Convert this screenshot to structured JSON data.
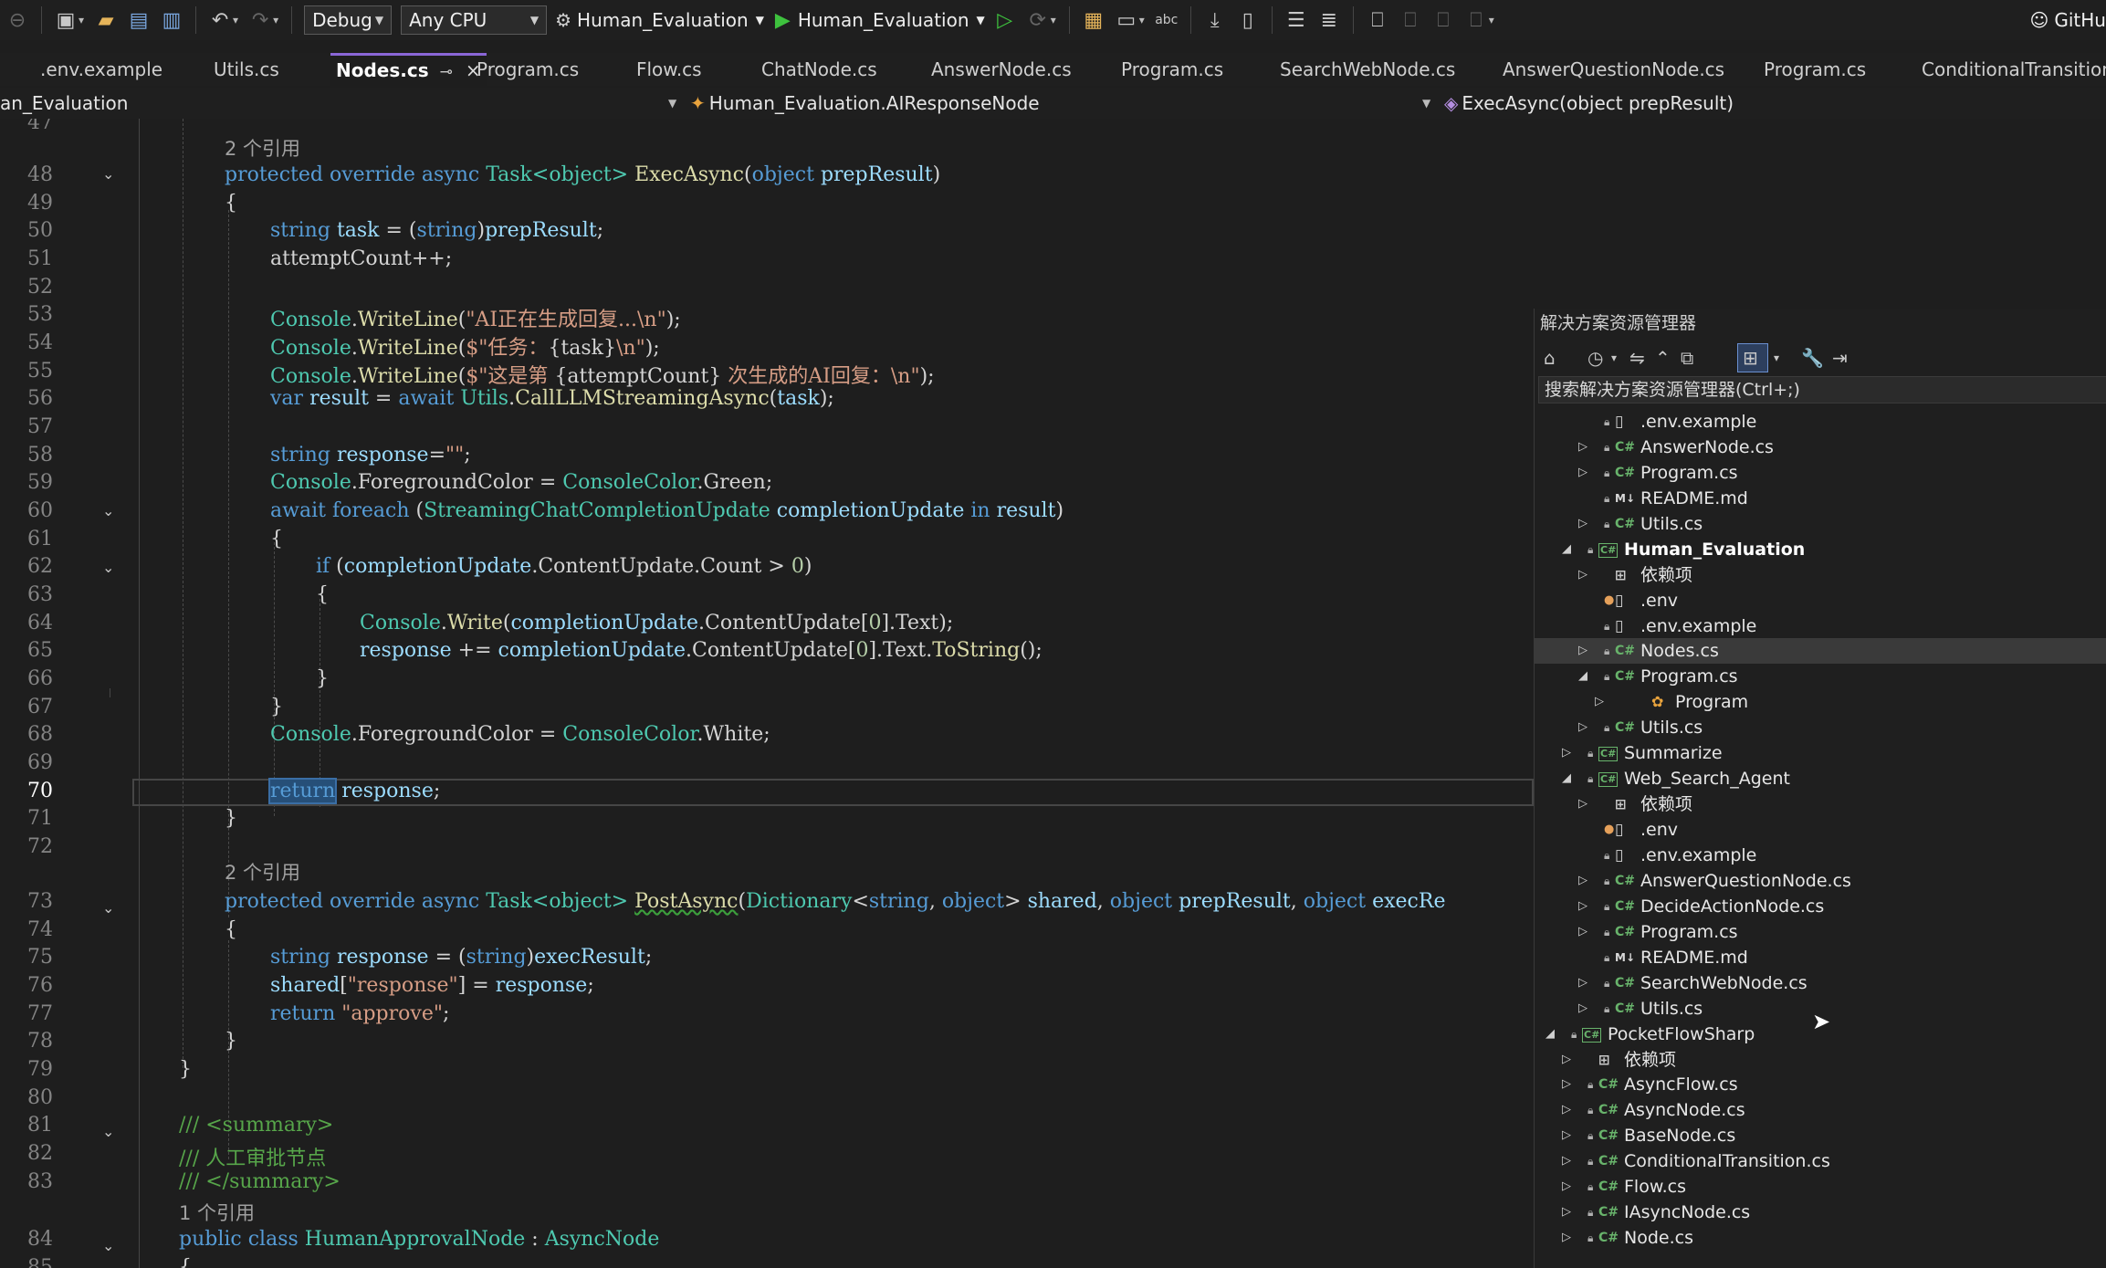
{
  "toolbar": {
    "configuration": "Debug",
    "platform": "Any CPU",
    "startup_project": "Human_Evaluation",
    "run_target": "Human_Evaluation",
    "github_label": "GitHu"
  },
  "tabs": [
    {
      "label": ".env.example"
    },
    {
      "label": "Utils.cs"
    },
    {
      "label": "Nodes.cs",
      "active": true
    },
    {
      "label": "Program.cs"
    },
    {
      "label": "Flow.cs"
    },
    {
      "label": "ChatNode.cs"
    },
    {
      "label": "AnswerNode.cs"
    },
    {
      "label": "Program.cs"
    },
    {
      "label": "SearchWebNode.cs"
    },
    {
      "label": "AnswerQuestionNode.cs"
    },
    {
      "label": "Program.cs"
    },
    {
      "label": "ConditionalTransition.cs"
    }
  ],
  "navbar": {
    "project": "an_Evaluation",
    "type": "Human_Evaluation.AIResponseNode",
    "member": "ExecAsync(object prepResult)"
  },
  "editor": {
    "line_numbers": [
      "47",
      "48",
      "49",
      "50",
      "51",
      "52",
      "53",
      "54",
      "55",
      "56",
      "57",
      "58",
      "59",
      "60",
      "61",
      "62",
      "63",
      "64",
      "65",
      "66",
      "67",
      "68",
      "69",
      "70",
      "71",
      "72",
      "73",
      "74",
      "75",
      "76",
      "77",
      "78",
      "79",
      "80",
      "81",
      "82",
      "83",
      "84",
      "85"
    ],
    "current_line": "70",
    "codelens": {
      "exec": "2 个引用",
      "post": "2 个引用",
      "class": "1 个引用"
    },
    "tokens": {
      "protected": "protected",
      "override": "override",
      "async": "async",
      "task_obj": "Task<object>",
      "exec_async": "ExecAsync",
      "object": "object",
      "prep_result": "prepResult",
      "string": "string",
      "task": "task",
      "attempt_count": "attemptCount++;",
      "console": "Console",
      "write_line": "WriteLine",
      "write": "Write",
      "str1": "\"AI正在生成回复...\\n\"",
      "str2a": "$\"任务：",
      "str2b": "{task}",
      "str2c": "\\n\"",
      "str3a": "$\"这是第 ",
      "str3b": "{attemptCount}",
      "str3c": " 次生成的AI回复：\\n\"",
      "var": "var",
      "result": "result",
      "await": "await",
      "utils": "Utils",
      "call_llm": "CallLLMStreamingAsync",
      "response": "response",
      "empty_str": "\"\"",
      "foreground": "ForegroundColor",
      "console_color": "ConsoleColor",
      "green": "Green",
      "white": "White",
      "foreach": "foreach",
      "streaming": "StreamingChatCompletionUpdate",
      "completion_update": "completionUpdate",
      "in": "in",
      "if": "if",
      "content_update": "ContentUpdate",
      "count": "Count",
      "zero": "0",
      "text": "Text",
      "to_string": "ToString",
      "return": "return",
      "post_async": "PostAsync",
      "dictionary": "Dictionary",
      "shared": "shared",
      "exec_re": "execRe",
      "exec_result": "execResult",
      "str_response": "\"response\"",
      "str_approve": "\"approve\"",
      "sum_open": "/// <summary>",
      "sum_text": "/// 人工审批节点",
      "sum_close": "/// </summary>",
      "public": "public",
      "class": "class",
      "human_approval": "HumanApprovalNode",
      "async_node": "AsyncNode"
    }
  },
  "solution_explorer": {
    "title": "解决方案资源管理器",
    "search_placeholder": "搜索解决方案资源管理器(Ctrl+;)",
    "items": [
      {
        "label": ".env.example"
      },
      {
        "label": "AnswerNode.cs"
      },
      {
        "label": "Program.cs"
      },
      {
        "label": "README.md"
      },
      {
        "label": "Utils.cs"
      },
      {
        "label": "Human_Evaluation"
      },
      {
        "label": "依赖项"
      },
      {
        "label": ".env"
      },
      {
        "label": ".env.example"
      },
      {
        "label": "Nodes.cs"
      },
      {
        "label": "Program.cs"
      },
      {
        "label": "Program"
      },
      {
        "label": "Utils.cs"
      },
      {
        "label": "Summarize"
      },
      {
        "label": "Web_Search_Agent"
      },
      {
        "label": "依赖项"
      },
      {
        "label": ".env"
      },
      {
        "label": ".env.example"
      },
      {
        "label": "AnswerQuestionNode.cs"
      },
      {
        "label": "DecideActionNode.cs"
      },
      {
        "label": "Program.cs"
      },
      {
        "label": "README.md"
      },
      {
        "label": "SearchWebNode.cs"
      },
      {
        "label": "Utils.cs"
      },
      {
        "label": "PocketFlowSharp"
      },
      {
        "label": "依赖项"
      },
      {
        "label": "AsyncFlow.cs"
      },
      {
        "label": "AsyncNode.cs"
      },
      {
        "label": "BaseNode.cs"
      },
      {
        "label": "ConditionalTransition.cs"
      },
      {
        "label": "Flow.cs"
      },
      {
        "label": "IAsyncNode.cs"
      },
      {
        "label": "Node.cs"
      }
    ]
  },
  "colors": {
    "keyword": "#569cd6",
    "type": "#4ec9b0",
    "method": "#dcdcaa",
    "string": "#d69d85",
    "comment": "#57a64a",
    "background": "#1e1e1e",
    "accent": "#8a66d6"
  }
}
